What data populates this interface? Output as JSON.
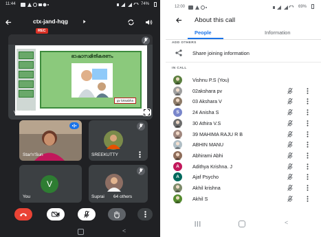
{
  "meeting": {
    "status": {
      "time": "11:44",
      "battery": "74%"
    },
    "code": "ctx-jand-hqg",
    "rec_badge": "REC",
    "presenting_label": "Vishnu is presenting",
    "slide": {
      "title": "ഭാഷാസമിതികരണം",
      "tag": "gv loksabha"
    },
    "tiles": [
      {
        "name": "Star'n'Sun",
        "speaking": true
      },
      {
        "name": "SREEKUTTY"
      },
      {
        "name": "You",
        "avatar_letter": "V",
        "avatar_color": "#2e7d32"
      },
      {
        "name": "Suprai",
        "extra": "64 others"
      }
    ],
    "controls": [
      "end-call",
      "camera-off",
      "mic-off",
      "raise-hand",
      "more"
    ],
    "colors": {
      "end_call": "#ea4335",
      "control_bg": "#ffffff"
    }
  },
  "about": {
    "status": {
      "time": "12:00",
      "battery": "69%"
    },
    "title": "About this call",
    "tabs": {
      "people": "People",
      "information": "Information"
    },
    "sections": {
      "add_others": "ADD OTHERS",
      "in_call": "IN CALL"
    },
    "share_label": "Share joining information",
    "accent": "#1a73e8",
    "participants": [
      {
        "name": "Vishnu P.S (You)",
        "avatar": "photo",
        "color": "#5b7f3f",
        "muted": false,
        "menu": false
      },
      {
        "name": "02akshara pv",
        "avatar": "photo",
        "color": "#9e9e9e",
        "muted": true,
        "menu": true
      },
      {
        "name": "03 Akshara V",
        "avatar": "photo",
        "color": "#8d7b68",
        "muted": true,
        "menu": true
      },
      {
        "name": "24 Anisha S",
        "avatar": "letter",
        "letter": "S",
        "color": "#7986cb",
        "muted": true,
        "menu": true
      },
      {
        "name": "30 Athira V.S",
        "avatar": "photo",
        "color": "#6d6d6d",
        "muted": true,
        "menu": true
      },
      {
        "name": "39 MAHIMA RAJU R B",
        "avatar": "photo",
        "color": "#a1887f",
        "muted": true,
        "menu": true
      },
      {
        "name": "ABHIN MANU",
        "avatar": "photo",
        "color": "#b0bec5",
        "muted": true,
        "menu": true
      },
      {
        "name": "Abhirami Abhi",
        "avatar": "photo",
        "color": "#8e6d5a",
        "muted": true,
        "menu": true
      },
      {
        "name": "Adithya Krishna. J",
        "avatar": "letter",
        "letter": "A",
        "color": "#c2185b",
        "muted": true,
        "menu": true
      },
      {
        "name": "Ajaf Psycho",
        "avatar": "letter",
        "letter": "A",
        "color": "#00695c",
        "muted": true,
        "menu": true
      },
      {
        "name": "Akhil krishna",
        "avatar": "photo",
        "color": "#7d8a6a",
        "muted": true,
        "menu": true
      },
      {
        "name": "Akhil S",
        "avatar": "photo",
        "color": "#558b2f",
        "muted": true,
        "menu": true
      }
    ]
  }
}
